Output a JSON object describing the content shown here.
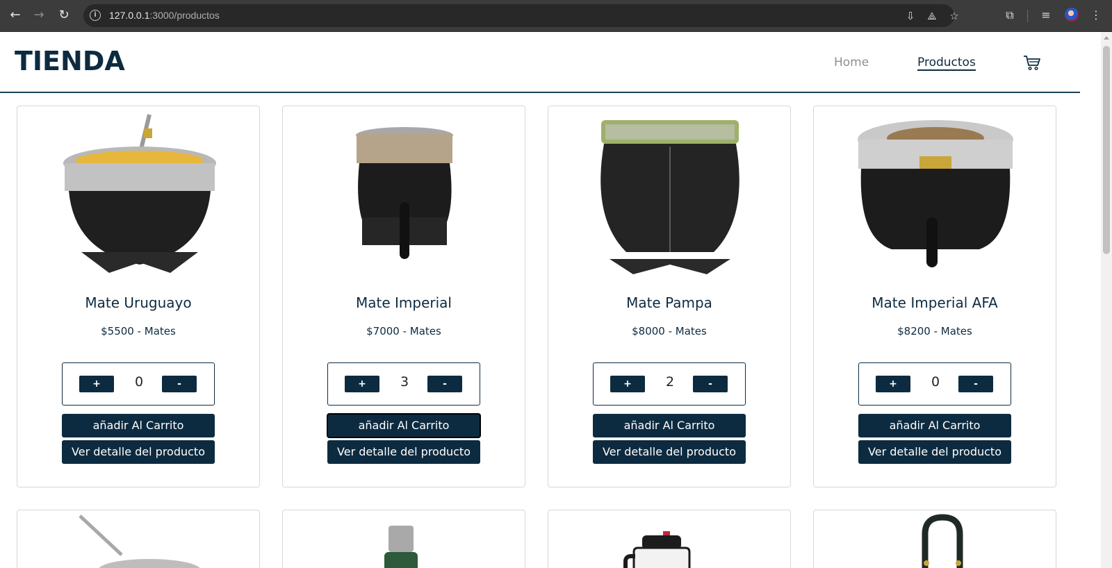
{
  "browser": {
    "url_host": "127.0.0.1",
    "url_path": ":3000/productos"
  },
  "header": {
    "brand": "TIENDA",
    "nav": [
      "Home",
      "Productos"
    ]
  },
  "products": [
    {
      "name": "Mate Uruguayo",
      "price_line": "$5500 - Mates",
      "qty": "0",
      "add_label": "añadir Al Carrito",
      "detail_label": "Ver detalle del producto"
    },
    {
      "name": "Mate Imperial",
      "price_line": "$7000 - Mates",
      "qty": "3",
      "add_label": "añadir Al Carrito",
      "detail_label": "Ver detalle del producto"
    },
    {
      "name": "Mate Pampa",
      "price_line": "$8000 - Mates",
      "qty": "2",
      "add_label": "añadir Al Carrito",
      "detail_label": "Ver detalle del producto"
    },
    {
      "name": "Mate Imperial AFA",
      "price_line": "$8200 - Mates",
      "qty": "0",
      "add_label": "añadir Al Carrito",
      "detail_label": "Ver detalle del producto"
    }
  ],
  "qty_controls": {
    "plus": "+",
    "minus": "-"
  },
  "colors": {
    "primary": "#0d2b40",
    "browser_bar": "#3c3c3c"
  }
}
